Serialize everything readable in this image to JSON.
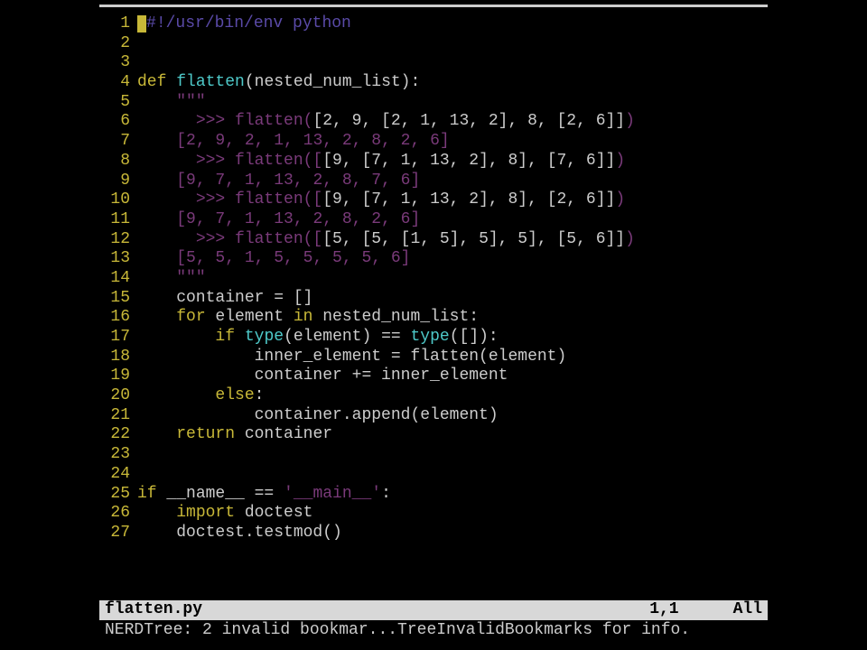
{
  "editor": {
    "lines": [
      {
        "n": 1,
        "segs": [
          {
            "t": "#",
            "c": "cmt"
          },
          {
            "t": "!/usr/bin/env python",
            "c": "cmt"
          }
        ],
        "cursor": true
      },
      {
        "n": 2,
        "segs": []
      },
      {
        "n": 3,
        "segs": []
      },
      {
        "n": 4,
        "segs": [
          {
            "t": "def ",
            "c": "kw"
          },
          {
            "t": "flatten",
            "c": "fn"
          },
          {
            "t": "(nested_num_list):",
            "c": ""
          }
        ]
      },
      {
        "n": 5,
        "segs": [
          {
            "t": "    ",
            "c": ""
          },
          {
            "t": "\"\"\"",
            "c": "strt"
          }
        ]
      },
      {
        "n": 6,
        "segs": [
          {
            "t": "      ",
            "c": ""
          },
          {
            "t": ">>> flatten(",
            "c": "strt"
          },
          {
            "t": "[2, 9, [2, 1, 13, 2], 8, [2, 6]]",
            "c": ""
          },
          {
            "t": ")",
            "c": "strt"
          }
        ]
      },
      {
        "n": 7,
        "segs": [
          {
            "t": "    ",
            "c": ""
          },
          {
            "t": "[2, 9, 2, 1, 13, 2, 8, 2, 6]",
            "c": "strt"
          }
        ]
      },
      {
        "n": 8,
        "segs": [
          {
            "t": "      ",
            "c": ""
          },
          {
            "t": ">>> flatten([",
            "c": "strt"
          },
          {
            "t": "[9, [7, 1, 13, 2], 8], [7, 6]]",
            "c": ""
          },
          {
            "t": ")",
            "c": "strt"
          }
        ]
      },
      {
        "n": 9,
        "segs": [
          {
            "t": "    ",
            "c": ""
          },
          {
            "t": "[9, 7, 1, 13, 2, 8, 7, 6]",
            "c": "strt"
          }
        ]
      },
      {
        "n": 10,
        "segs": [
          {
            "t": "      ",
            "c": ""
          },
          {
            "t": ">>> flatten([",
            "c": "strt"
          },
          {
            "t": "[9, [7, 1, 13, 2], 8], [2, 6]]",
            "c": ""
          },
          {
            "t": ")",
            "c": "strt"
          }
        ]
      },
      {
        "n": 11,
        "segs": [
          {
            "t": "    ",
            "c": ""
          },
          {
            "t": "[9, 7, 1, 13, 2, 8, 2, 6]",
            "c": "strt"
          }
        ]
      },
      {
        "n": 12,
        "segs": [
          {
            "t": "      ",
            "c": ""
          },
          {
            "t": ">>> flatten([",
            "c": "strt"
          },
          {
            "t": "[5, [5, [1, 5], 5], 5], [5, 6]]",
            "c": ""
          },
          {
            "t": ")",
            "c": "strt"
          }
        ]
      },
      {
        "n": 13,
        "segs": [
          {
            "t": "    ",
            "c": ""
          },
          {
            "t": "[5, 5, 1, 5, 5, 5, 5, 6]",
            "c": "strt"
          }
        ]
      },
      {
        "n": 14,
        "segs": [
          {
            "t": "    ",
            "c": ""
          },
          {
            "t": "\"\"\"",
            "c": "strt"
          }
        ]
      },
      {
        "n": 15,
        "segs": [
          {
            "t": "    container = []",
            "c": ""
          }
        ]
      },
      {
        "n": 16,
        "segs": [
          {
            "t": "    ",
            "c": ""
          },
          {
            "t": "for",
            "c": "kw"
          },
          {
            "t": " element ",
            "c": ""
          },
          {
            "t": "in",
            "c": "kw"
          },
          {
            "t": " nested_num_list:",
            "c": ""
          }
        ]
      },
      {
        "n": 17,
        "segs": [
          {
            "t": "        ",
            "c": ""
          },
          {
            "t": "if",
            "c": "kw"
          },
          {
            "t": " ",
            "c": ""
          },
          {
            "t": "type",
            "c": "ty"
          },
          {
            "t": "(element) == ",
            "c": ""
          },
          {
            "t": "type",
            "c": "ty"
          },
          {
            "t": "([]):",
            "c": ""
          }
        ]
      },
      {
        "n": 18,
        "segs": [
          {
            "t": "            inner_element = flatten(element)",
            "c": ""
          }
        ]
      },
      {
        "n": 19,
        "segs": [
          {
            "t": "            container += inner_element",
            "c": ""
          }
        ]
      },
      {
        "n": 20,
        "segs": [
          {
            "t": "        ",
            "c": ""
          },
          {
            "t": "else",
            "c": "kw"
          },
          {
            "t": ":",
            "c": ""
          }
        ]
      },
      {
        "n": 21,
        "segs": [
          {
            "t": "            container.append(element)",
            "c": ""
          }
        ]
      },
      {
        "n": 22,
        "segs": [
          {
            "t": "    ",
            "c": ""
          },
          {
            "t": "return",
            "c": "kw"
          },
          {
            "t": " container",
            "c": ""
          }
        ]
      },
      {
        "n": 23,
        "segs": []
      },
      {
        "n": 24,
        "segs": []
      },
      {
        "n": 25,
        "segs": [
          {
            "t": "if",
            "c": "kw"
          },
          {
            "t": " __name__ == ",
            "c": ""
          },
          {
            "t": "'__main__'",
            "c": "strt"
          },
          {
            "t": ":",
            "c": ""
          }
        ]
      },
      {
        "n": 26,
        "segs": [
          {
            "t": "    ",
            "c": ""
          },
          {
            "t": "import",
            "c": "kw"
          },
          {
            "t": " doctest",
            "c": ""
          }
        ]
      },
      {
        "n": 27,
        "segs": [
          {
            "t": "    doctest.testmod()",
            "c": ""
          }
        ]
      }
    ]
  },
  "status": {
    "filename": "flatten.py",
    "position": "1,1",
    "percent": "All"
  },
  "message": "NERDTree: 2 invalid bookmar...TreeInvalidBookmarks for info."
}
